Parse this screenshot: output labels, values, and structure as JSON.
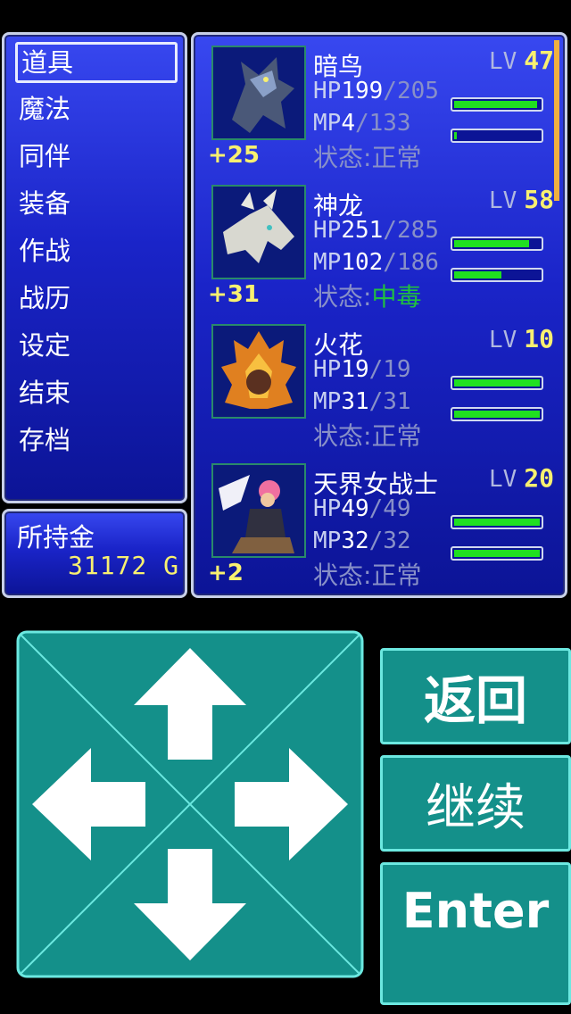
{
  "menu": {
    "items": [
      "道具",
      "魔法",
      "同伴",
      "装备",
      "作战",
      "战历",
      "设定",
      "结束",
      "存档"
    ],
    "selected_index": 0
  },
  "gold": {
    "label": "所持金",
    "value": "31172 G"
  },
  "party": [
    {
      "name": "暗鸟",
      "lv_label": "LV",
      "lv": "47",
      "hp_label": "HP",
      "hp": "199",
      "hp_max": "205",
      "mp_label": "MP",
      "mp": "4",
      "mp_max": "133",
      "status_label": "状态:",
      "status": "正常",
      "bonus": "+25",
      "hp_fraction": 0.97,
      "mp_fraction": 0.03,
      "portrait_icon": "dark-bird-icon"
    },
    {
      "name": "神龙",
      "lv_label": "LV",
      "lv": "58",
      "hp_label": "HP",
      "hp": "251",
      "hp_max": "285",
      "mp_label": "MP",
      "mp": "102",
      "mp_max": "186",
      "status_label": "状态:",
      "status": "中毒",
      "bonus": "+31",
      "hp_fraction": 0.88,
      "mp_fraction": 0.55,
      "portrait_icon": "dragon-icon"
    },
    {
      "name": "火花",
      "lv_label": "LV",
      "lv": "10",
      "hp_label": "HP",
      "hp": "19",
      "hp_max": "19",
      "mp_label": "MP",
      "mp": "31",
      "mp_max": "31",
      "status_label": "状态:",
      "status": "正常",
      "bonus": "",
      "hp_fraction": 1.0,
      "mp_fraction": 1.0,
      "portrait_icon": "fire-spirit-icon"
    },
    {
      "name": "天界女战士",
      "lv_label": "LV",
      "lv": "20",
      "hp_label": "HP",
      "hp": "49",
      "hp_max": "49",
      "mp_label": "MP",
      "mp": "32",
      "mp_max": "32",
      "status_label": "状态:",
      "status": "正常",
      "bonus": "+2",
      "hp_fraction": 1.0,
      "mp_fraction": 1.0,
      "portrait_icon": "valkyrie-icon"
    }
  ],
  "controls": {
    "back": "返回",
    "continue": "继续",
    "enter": "Enter"
  },
  "colors": {
    "panel": "#1a24c8",
    "gold_text": "#f8f070",
    "bar_fill": "#20e020",
    "button": "#14908a"
  }
}
